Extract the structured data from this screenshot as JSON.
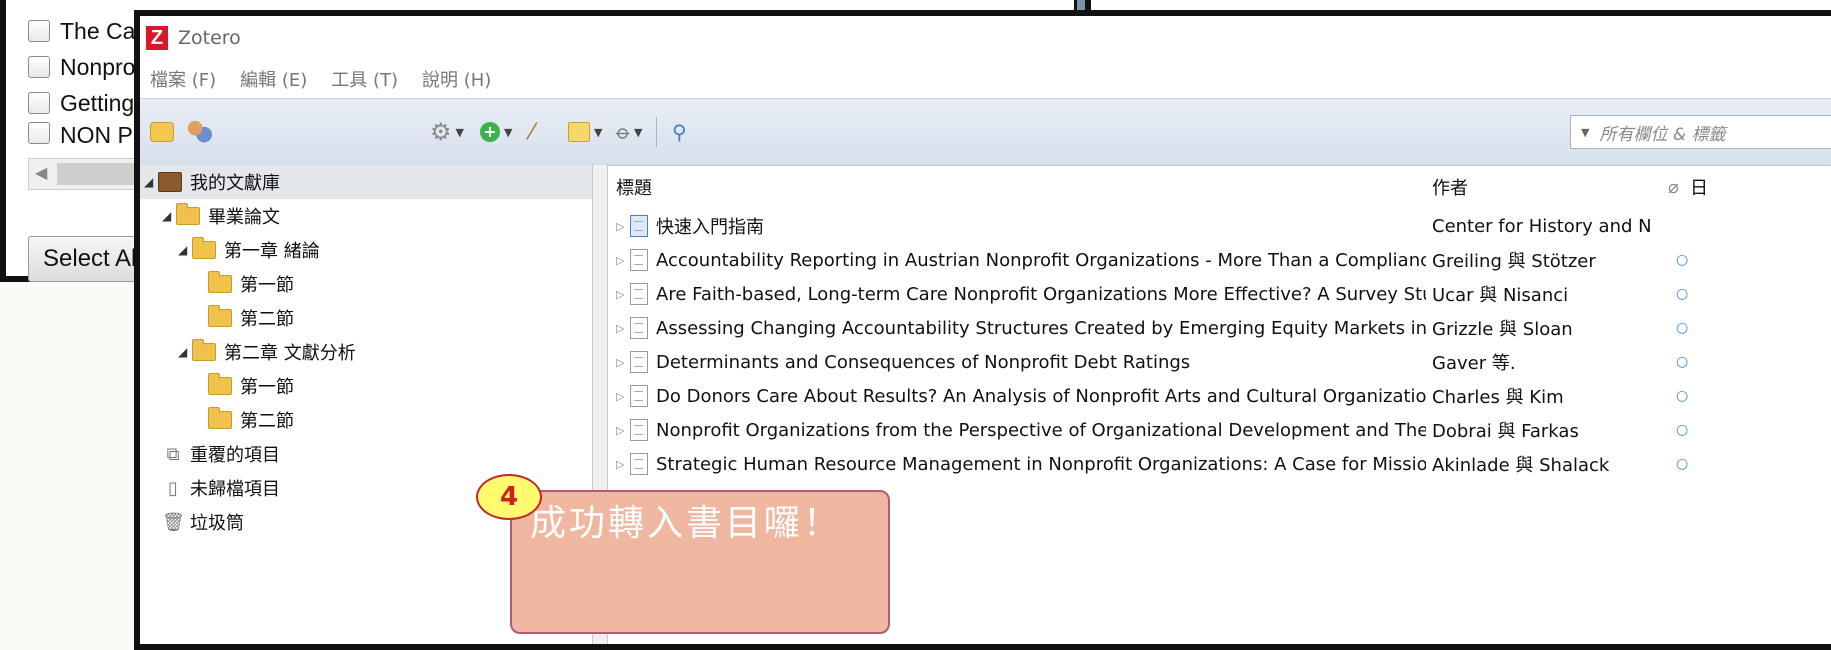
{
  "background_dialog": {
    "checkbox_items": [
      "The Cau",
      "Nonprof",
      "Getting",
      "NON PF"
    ],
    "select_all_label": "Select Al"
  },
  "window": {
    "title": "Zotero",
    "logo_letter": "Z"
  },
  "menubar": [
    "檔案 (F)",
    "編輯 (E)",
    "工具 (T)",
    "說明 (H)"
  ],
  "toolbar": {
    "icons": [
      "new-collection-icon",
      "new-group-icon",
      "actions-gear-icon",
      "new-item-icon",
      "add-by-identifier-wand-icon",
      "new-note-icon",
      "attachment-paperclip-icon",
      "advanced-search-icon"
    ],
    "search_placeholder": "所有欄位 & 標籤"
  },
  "collections": {
    "library": "我的文獻庫",
    "items": [
      {
        "label": "畢業論文",
        "level": 1,
        "twisty": "◢"
      },
      {
        "label": "第一章 緒論",
        "level": 2,
        "twisty": "◢"
      },
      {
        "label": "第一節",
        "level": 3,
        "twisty": ""
      },
      {
        "label": "第二節",
        "level": 3,
        "twisty": ""
      },
      {
        "label": "第二章 文獻分析",
        "level": 2,
        "twisty": "◢"
      },
      {
        "label": "第一節",
        "level": 3,
        "twisty": ""
      },
      {
        "label": "第二節",
        "level": 3,
        "twisty": ""
      }
    ],
    "duplicates": "重覆的項目",
    "unfiled": "未歸檔項目",
    "trash": "垃圾筒"
  },
  "items_table": {
    "columns": {
      "title": "標題",
      "author": "作者",
      "extra": "日"
    },
    "rows": [
      {
        "title": "快速入門指南",
        "author": "Center for History and New ...",
        "attachment": "",
        "guide": true
      },
      {
        "title": "Accountability Reporting in Austrian Nonprofit Organizations - More Than a Compliance Instrument?",
        "author": "Greiling 與 Stötzer",
        "attachment": "○",
        "guide": false
      },
      {
        "title": "Are Faith-based, Long-term Care Nonprofit Organizations More Effective? A Survey Study of Nursing ...",
        "author": "Ucar 與 Nisanci",
        "attachment": "○",
        "guide": false
      },
      {
        "title": "Assessing Changing Accountability Structures Created by Emerging Equity Markets in the Nonprofit Se...",
        "author": "Grizzle 與 Sloan",
        "attachment": "○",
        "guide": false
      },
      {
        "title": "Determinants and Consequences of Nonprofit Debt Ratings",
        "author": "Gaver 等.",
        "attachment": "○",
        "guide": false
      },
      {
        "title": "Do Donors Care About Results? An Analysis of Nonprofit Arts and Cultural Organizations",
        "author": "Charles 與 Kim",
        "attachment": "○",
        "guide": false
      },
      {
        "title": "Nonprofit Organizations from the Perspective of Organizational Development and Their Influence on ...",
        "author": "Dobrai 與 Farkas",
        "attachment": "○",
        "guide": false
      },
      {
        "title": "Strategic Human Resource Management in Nonprofit Organizations: A Case for Mission-Driven Huma...",
        "author": "Akinlade 與 Shalack",
        "attachment": "○",
        "guide": false
      }
    ]
  },
  "annotation": {
    "step_number": "4",
    "text": "成功轉入書目囉！"
  },
  "colors": {
    "callout_fill": "#efb6a0",
    "callout_border": "#b25a7a",
    "badge_fill": "#fffa6e",
    "badge_text": "#d21e1e",
    "logo_red": "#d7182a"
  }
}
